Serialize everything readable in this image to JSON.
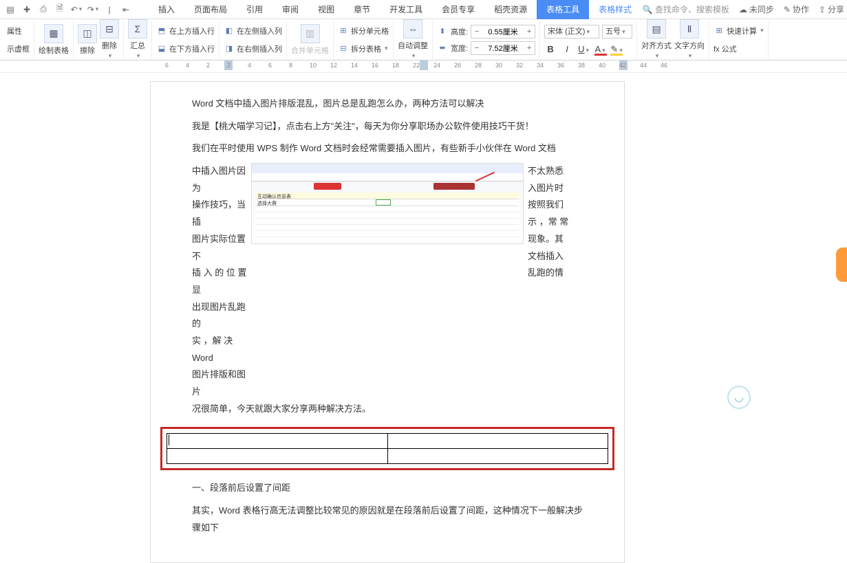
{
  "qbar": {
    "tabs": [
      "插入",
      "页面布局",
      "引用",
      "审阅",
      "视图",
      "章节",
      "开发工具",
      "会员专享",
      "稻壳资源"
    ],
    "active_tab": "表格工具",
    "sub_tab": "表格样式",
    "search_placeholder": "查找命令、搜索模板",
    "right": {
      "unsync": "未同步",
      "collab": "协作",
      "share": "分享"
    }
  },
  "ribbon": {
    "prop": "属性",
    "showbox": "示虚框",
    "drawtable": "绘制表格",
    "erase": "擦除",
    "delete": "删除",
    "summary": "汇总",
    "ins_above": "在上方插入行",
    "ins_below": "在下方插入行",
    "ins_left": "在左侧插入列",
    "ins_right": "在右侧插入列",
    "merge": "合并单元格",
    "split_cell": "拆分单元格",
    "split_table": "拆分表格",
    "autofit": "自动调整",
    "height_lbl": "高度:",
    "height_val": "0.55厘米",
    "width_lbl": "宽度:",
    "width_val": "7.52厘米",
    "font": "宋体 (正文)",
    "size": "五号",
    "align": "对齐方式",
    "textdir": "文字方向",
    "fastcalc": "快速计算",
    "formula": "fx 公式"
  },
  "ruler_ticks": [
    "6",
    "4",
    "2",
    "2",
    "4",
    "6",
    "8",
    "10",
    "12",
    "14",
    "16",
    "18",
    "22",
    "24",
    "26",
    "28",
    "30",
    "32",
    "34",
    "36",
    "38",
    "40",
    "42",
    "44",
    "46"
  ],
  "doc": {
    "p1": "Word 文档中插入图片排版混乱，图片总是乱跑怎么办，两种方法可以解决",
    "p2": "我是【桃大喵学习记】，点击右上方\"关注\"，每天为你分享职场办公软件使用技巧干货！",
    "p3": "我们在平时使用 WPS 制作 Word 文档时会经常需要插入图片，有些新手小伙伴在 Word 文档",
    "l": [
      "中插入图片因为",
      "操作技巧，当插",
      "图片实际位置不",
      "插 入 的 位 置 显",
      "出现图片乱跑的",
      "实 ，解 决  Word",
      "图片排版和图片"
    ],
    "r": [
      "不太熟悉",
      "入图片时",
      "按照我们",
      "示 ，常 常",
      "现象。其",
      "文档插入",
      "乱跑的情"
    ],
    "p4": "况很简单，今天就跟大家分享两种解决方法。",
    "h2": "一、段落前后设置了间距",
    "p5": "其实，Word 表格行高无法调整比较常见的原因就是在段落前后设置了间距，这种情况下一般解决步骤如下",
    "embed_title": "互动确认信息表",
    "embed_sub": "选择大赛"
  }
}
